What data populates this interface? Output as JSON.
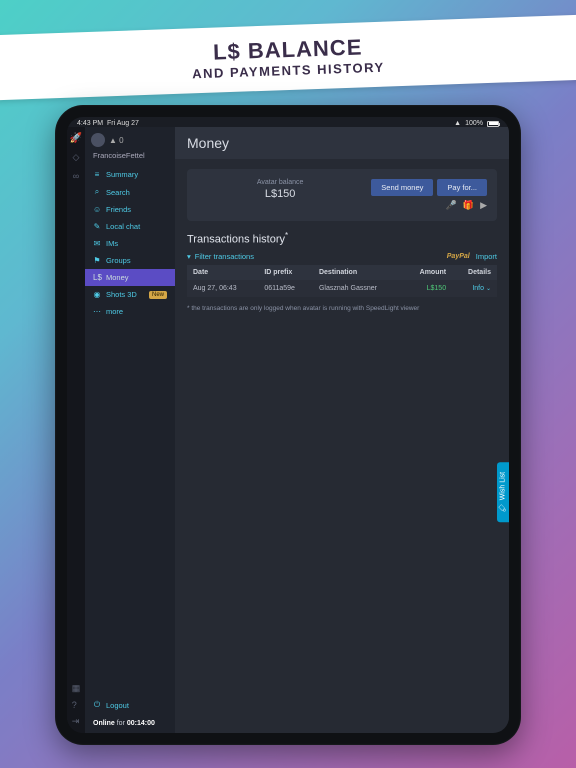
{
  "promo": {
    "title": "L$ BALANCE",
    "subtitle": "AND PAYMENTS HISTORY"
  },
  "statusbar": {
    "time": "4:43 PM",
    "date": "Fri Aug 27",
    "battery": "100%"
  },
  "profile": {
    "status_count": "0",
    "username": "FrancoiseFettel"
  },
  "sidebar": {
    "items": [
      {
        "icon": "≡",
        "label": "Summary",
        "name": "summary"
      },
      {
        "icon": "⌕",
        "label": "Search",
        "name": "search"
      },
      {
        "icon": "☺",
        "label": "Friends",
        "name": "friends"
      },
      {
        "icon": "✎",
        "label": "Local chat",
        "name": "local-chat"
      },
      {
        "icon": "✉",
        "label": "IMs",
        "name": "ims"
      },
      {
        "icon": "⚑",
        "label": "Groups",
        "name": "groups"
      },
      {
        "icon": "L$",
        "label": "Money",
        "name": "money",
        "active": true
      },
      {
        "icon": "◉",
        "label": "Shots 3D",
        "name": "shots-3d",
        "badge": "New"
      },
      {
        "icon": "⋯",
        "label": "more",
        "name": "more"
      }
    ],
    "logout_label": "Logout",
    "online_prefix": "Online",
    "online_for": "for",
    "online_time": "00:14:00"
  },
  "main": {
    "page_title": "Money",
    "balance_label": "Avatar balance",
    "balance_amount": "L$150",
    "send_money": "Send money",
    "pay_for": "Pay for...",
    "transactions_title": "Transactions history",
    "filter_label": "Filter transactions",
    "import_label": "Import",
    "paypal_label": "PayPal",
    "columns": {
      "date": "Date",
      "id_prefix": "ID prefix",
      "destination": "Destination",
      "amount": "Amount",
      "details": "Details"
    },
    "rows": [
      {
        "date": "Aug 27, 06:43",
        "id_prefix": "0611a59e",
        "destination": "Glasznah Gassner",
        "amount": "L$150",
        "details": "Info"
      }
    ],
    "footnote": "* the transactions are only logged when avatar is running with SpeedLight viewer"
  },
  "wishlist": {
    "label": "Wish List"
  }
}
